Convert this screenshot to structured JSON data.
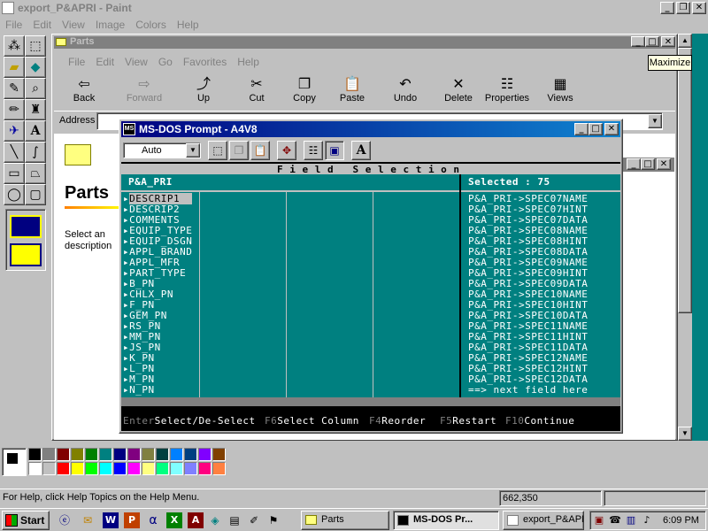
{
  "paint": {
    "title": "export_P&APRI - Paint",
    "menu": [
      "File",
      "Edit",
      "View",
      "Image",
      "Colors",
      "Help"
    ],
    "status_help": "For Help, click Help Topics on the Help Menu.",
    "status_coords": "662,350",
    "palette_top": [
      "#000000",
      "#808080",
      "#800000",
      "#808000",
      "#008000",
      "#008080",
      "#000080",
      "#800080",
      "#808040",
      "#004040",
      "#0080ff",
      "#004080",
      "#8000ff",
      "#804000"
    ],
    "palette_bottom": [
      "#ffffff",
      "#c0c0c0",
      "#ff0000",
      "#ffff00",
      "#00ff00",
      "#00ffff",
      "#0000ff",
      "#ff00ff",
      "#ffff80",
      "#00ff80",
      "#80ffff",
      "#8080ff",
      "#ff0080",
      "#ff8040"
    ]
  },
  "explorer": {
    "title": "Parts",
    "menu": [
      "File",
      "Edit",
      "View",
      "Go",
      "Favorites",
      "Help"
    ],
    "toolbar": {
      "back": "Back",
      "forward": "Forward",
      "up": "Up",
      "cut": "Cut",
      "copy": "Copy",
      "paste": "Paste",
      "undo": "Undo",
      "delete": "Delete",
      "properties": "Properties",
      "views": "Views"
    },
    "address_label": "Address",
    "folder_title": "Parts",
    "description": "Select an description",
    "tooltip": "Maximize"
  },
  "dos": {
    "title": "MS-DOS Prompt - A4V8",
    "font_select": "Auto",
    "header": "F i e l d   S e l e c t i o n",
    "table_name": "P&A_PRI",
    "selected_count": "Selected : 75",
    "fields": [
      "DESCRIP1",
      "DESCRIP2",
      "COMMENTS",
      "EQUIP_TYPE",
      "EQUIP_DSGN",
      "APPL_BRAND",
      "APPL_MFR",
      "PART_TYPE",
      "B_PN",
      "CHLX_PN",
      "F_PN",
      "GEM_PN",
      "RS_PN",
      "MM_PN",
      "JS_PN",
      "K_PN",
      "L_PN",
      "M_PN",
      "N_PN"
    ],
    "selected": [
      "P&A_PRI->SPEC07NAME",
      "P&A_PRI->SPEC07HINT",
      "P&A_PRI->SPEC07DATA",
      "P&A_PRI->SPEC08NAME",
      "P&A_PRI->SPEC08HINT",
      "P&A_PRI->SPEC08DATA",
      "P&A_PRI->SPEC09NAME",
      "P&A_PRI->SPEC09HINT",
      "P&A_PRI->SPEC09DATA",
      "P&A_PRI->SPEC10NAME",
      "P&A_PRI->SPEC10HINT",
      "P&A_PRI->SPEC10DATA",
      "P&A_PRI->SPEC11NAME",
      "P&A_PRI->SPEC11HINT",
      "P&A_PRI->SPEC11DATA",
      "P&A_PRI->SPEC12NAME",
      "P&A_PRI->SPEC12HINT",
      "P&A_PRI->SPEC12DATA",
      "==> next field here"
    ],
    "footer": [
      {
        "key": "Enter",
        "label": "Select/De-Select"
      },
      {
        "key": "F6",
        "label": "Select Column"
      },
      {
        "key": "F4",
        "label": "Reorder"
      },
      {
        "key": "F5",
        "label": "Restart"
      },
      {
        "key": "F10",
        "label": "Continue"
      }
    ]
  },
  "taskbar": {
    "start": "Start",
    "tasks": [
      "Parts",
      "MS-DOS Pr...",
      "export_P&APR..."
    ],
    "clock": "6:09 PM"
  }
}
